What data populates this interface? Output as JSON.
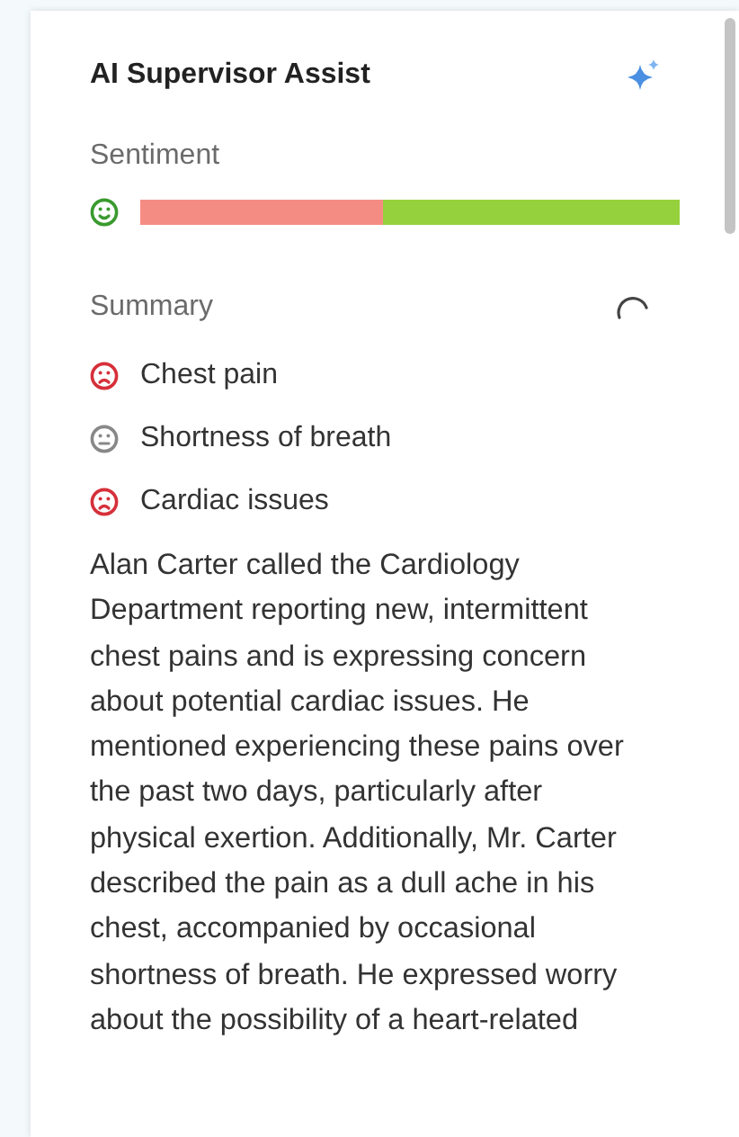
{
  "panel": {
    "title": "AI Supervisor Assist"
  },
  "sentiment": {
    "label": "Sentiment",
    "kind": "positive",
    "level": 0.55
  },
  "summary": {
    "label": "Summary",
    "loading": true,
    "topics": [
      {
        "label": "Chest pain",
        "kind": "negative"
      },
      {
        "label": "Shortness of breath",
        "kind": "neutral"
      },
      {
        "label": "Cardiac issues",
        "kind": "negative"
      }
    ],
    "text": "Alan Carter called the Cardiology Department reporting new, intermittent chest pains and is expressing concern about potential cardiac issues. He mentioned experiencing these pains over the past two days, particularly after physical exertion. Additionally, Mr. Carter described the pain as a dull ache in his chest, accompanied by occasional shortness of breath. He expressed worry about the possibility of a heart-related"
  }
}
